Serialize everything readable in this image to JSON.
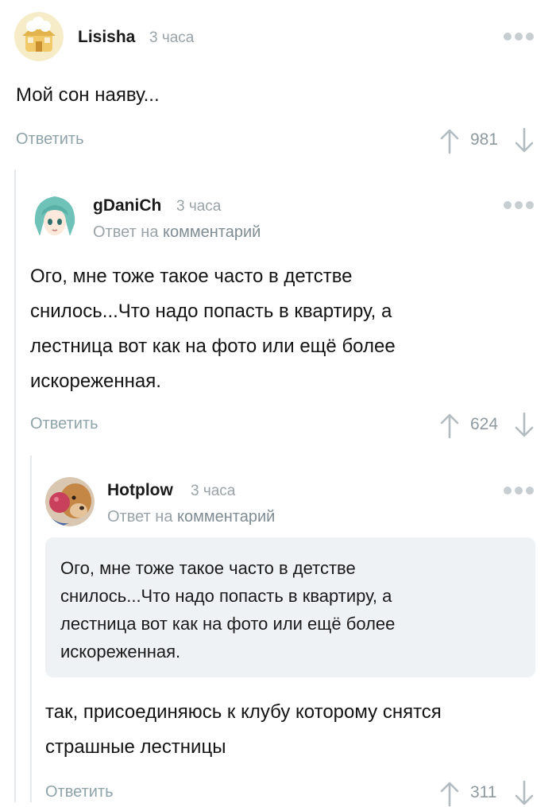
{
  "comments": [
    {
      "username": "Lisisha",
      "time": "3 часа",
      "text": "Мой сон наяву...",
      "reply_label": "Ответить",
      "score": "981"
    },
    {
      "username": "gDaniCh",
      "time": "3 часа",
      "reply_prefix": "Ответ на",
      "reply_link": "комментарий",
      "text_lines": [
        "Ого, мне тоже такое часто в детстве",
        "снилось...Что надо попасть в квартиру, а",
        "лестница вот как на фото или ещё более",
        "искореженная."
      ],
      "reply_label": "Ответить",
      "score": "624"
    },
    {
      "username": "Hotplow",
      "time": "3 часа",
      "reply_prefix": "Ответ на",
      "reply_link": "комментарий",
      "quote_lines": [
        "Ого, мне тоже такое часто в детстве",
        "снилось...Что надо попасть в квартиру, а",
        "лестница вот как на фото или ещё более",
        "искореженная."
      ],
      "text_lines": [
        "так, присоединяюсь к клубу которому снятся",
        "страшные лестницы"
      ],
      "reply_label": "Ответить",
      "score": "311"
    }
  ],
  "icons": {
    "more": "more-dots-icon",
    "upvote": "arrow-up-icon",
    "downvote": "arrow-down-icon"
  },
  "colors": {
    "link": "#8ea3aa",
    "muted": "#9aa3a8",
    "quote_bg": "#eef2f4"
  }
}
